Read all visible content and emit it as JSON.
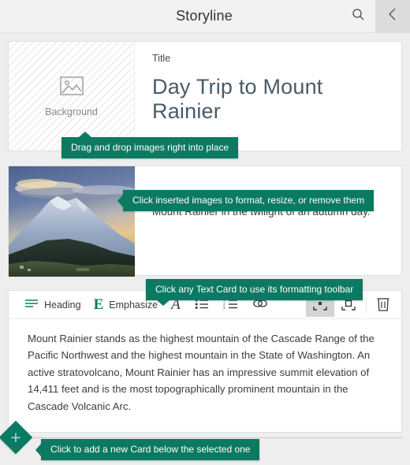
{
  "header": {
    "title": "Storyline",
    "search_icon": "search-icon",
    "back_icon": "chevron-left-icon"
  },
  "cards": {
    "title_card": {
      "background_icon": "image-placeholder-icon",
      "background_label": "Background",
      "kicker": "Title",
      "heading": "Day Trip to Mount Rainier"
    },
    "image_card": {
      "image_alt": "Mount Rainier at twilight",
      "caption": "Mount Rainier in the twilight of an autumn day."
    },
    "text_card": {
      "toolbar": {
        "heading_label": "Heading",
        "heading_icon": "heading-lines-icon",
        "emphasize_label": "Emphasize",
        "emphasize_icon": "bold-e-icon",
        "italic_icon": "italic-a-icon",
        "bullet_list_icon": "bullet-list-icon",
        "numbered_list_icon": "numbered-list-icon",
        "link_icon": "link-icon",
        "fit_small_icon": "fit-small-icon",
        "fit_large_icon": "fit-large-icon",
        "delete_icon": "trash-icon"
      },
      "body": "Mount Rainier stands as the highest mountain of the Cascade Range of the Pacific Northwest and the highest mountain in the State of Washington. An active stratovolcano, Mount Rainier has an impressive summit elevation of 14,411 feet and is the most topographically prominent mountain in the Cascade Volcanic Arc."
    }
  },
  "tooltips": {
    "drag_drop": "Drag and drop images right into place",
    "click_images": "Click inserted images to format, resize, or remove them",
    "click_text_card": "Click any Text Card to use its formatting toolbar",
    "add_card": "Click to add a new Card below the selected one"
  },
  "add_control": {
    "icon": "plus-diamond-icon"
  },
  "colors": {
    "accent_teal": "#0c7a62",
    "canvas": "#eeeeee",
    "title_text": "#4a5a68"
  }
}
